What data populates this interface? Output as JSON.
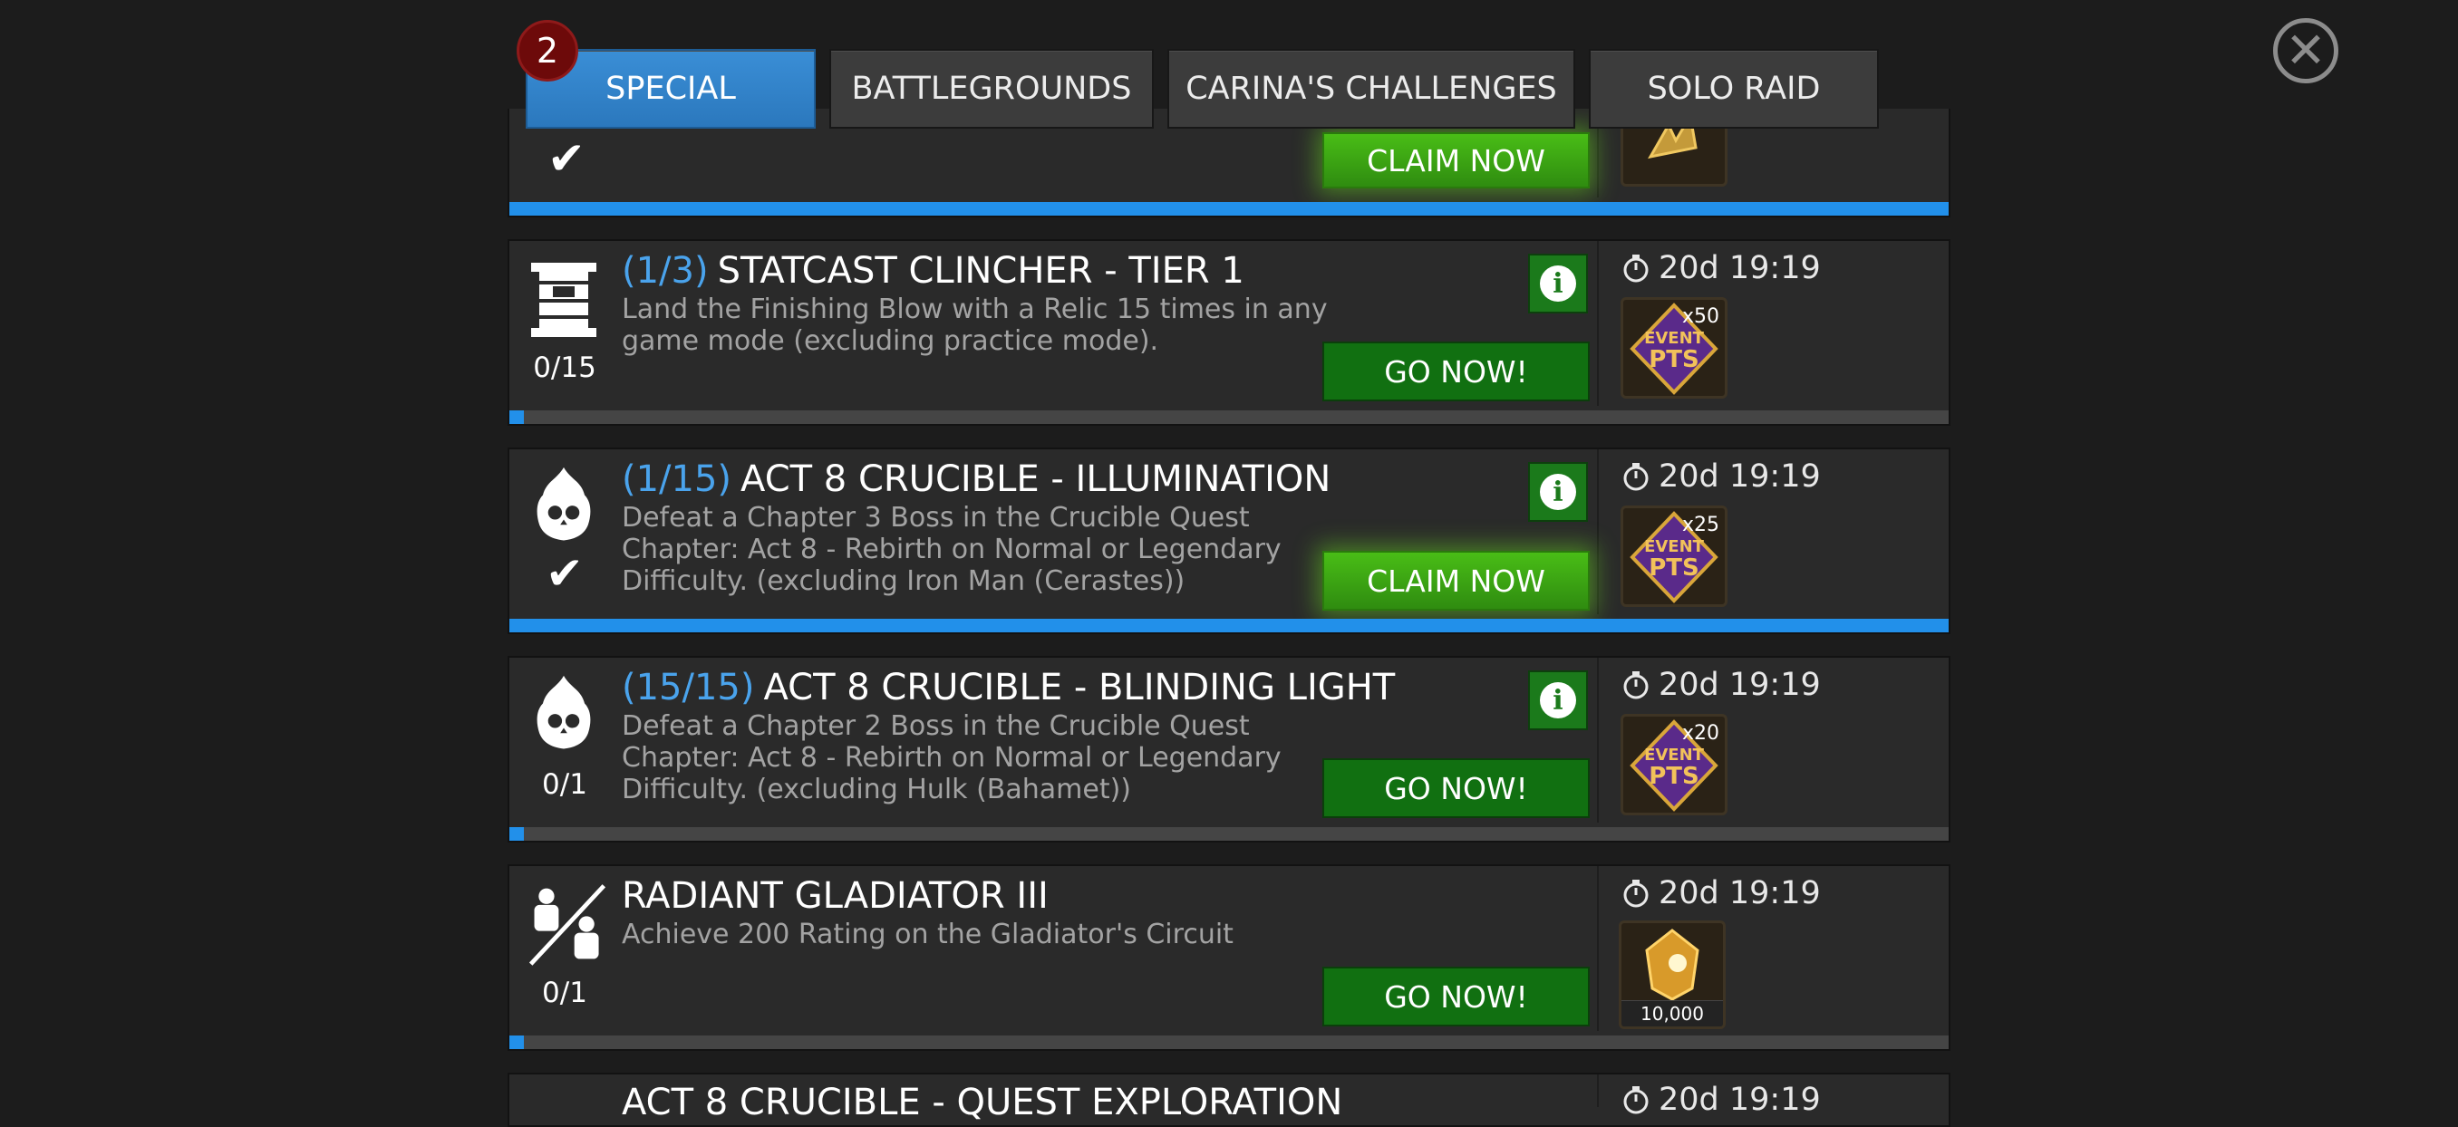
{
  "tabs": [
    {
      "label": "SPECIAL",
      "active": true
    },
    {
      "label": "BATTLEGROUNDS",
      "active": false
    },
    {
      "label": "CARINA'S CHALLENGES",
      "active": false
    },
    {
      "label": "SOLO RAID",
      "active": false
    }
  ],
  "badge": "2",
  "close_icon": "close-circle-icon",
  "top_card": {
    "action": "CLAIM NOW",
    "progress": 1.0
  },
  "objectives": [
    {
      "tier": "(1/3)",
      "title": "STATCAST CLINCHER - TIER 1",
      "description": "Land the Finishing Blow with a Relic 15 times in any game mode (excluding practice mode).",
      "count": "0/15",
      "action": "GO NOW!",
      "timer": "20d 19:19",
      "reward_multiplier": "x50",
      "reward_label": "EVENT PTS",
      "progress": 0.0
    },
    {
      "tier": "(1/15)",
      "title": "ACT 8 CRUCIBLE - ILLUMINATION",
      "description": "Defeat a Chapter 3 Boss in the Crucible Quest Chapter: Act 8 - Rebirth on Normal or Legendary Difficulty. (excluding Iron Man (Cerastes))",
      "count": "",
      "action": "CLAIM NOW",
      "timer": "20d 19:19",
      "reward_multiplier": "x25",
      "reward_label": "EVENT PTS",
      "progress": 1.0
    },
    {
      "tier": "(15/15)",
      "title": "ACT 8 CRUCIBLE - BLINDING LIGHT",
      "description": "Defeat a Chapter 2 Boss in the Crucible Quest Chapter: Act 8 - Rebirth on Normal or Legendary Difficulty. (excluding Hulk (Bahamet))",
      "count": "0/1",
      "action": "GO NOW!",
      "timer": "20d 19:19",
      "reward_multiplier": "x20",
      "reward_label": "EVENT PTS",
      "progress": 0.0
    },
    {
      "tier": "",
      "title": "RADIANT GLADIATOR III",
      "description": "Achieve 200 Rating on the Gladiator's Circuit",
      "count": "0/1",
      "action": "GO NOW!",
      "timer": "20d 19:19",
      "reward_multiplier": "",
      "reward_amount": "10,000",
      "progress": 0.0
    }
  ],
  "bottom_card": {
    "title": "ACT 8 CRUCIBLE - QUEST EXPLORATION",
    "timer": "20d 19:19"
  }
}
